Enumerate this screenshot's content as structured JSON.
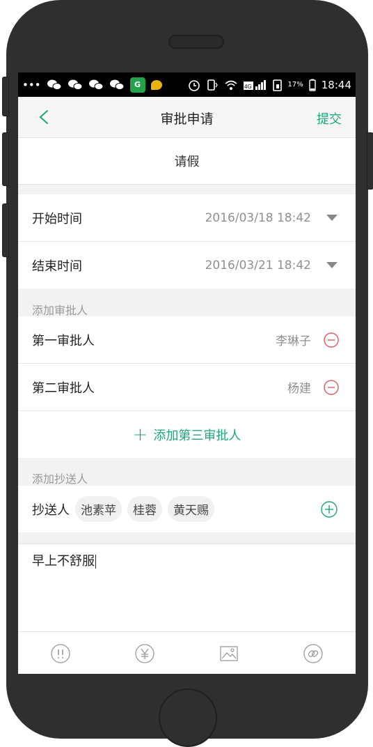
{
  "status_bar": {
    "time": "18:44",
    "battery": "17%",
    "network": "4G",
    "icons": [
      "more-dots-icon",
      "wechat-icon",
      "wechat-icon",
      "wechat-icon",
      "wechat-icon",
      "app-badge-icon",
      "message-bubble-icon",
      "alarm-icon",
      "vibrate-icon",
      "wifi-icon",
      "signal-icon",
      "sim-icon",
      "battery-icon"
    ]
  },
  "nav": {
    "title": "审批申请",
    "submit_label": "提交"
  },
  "leave_type": "请假",
  "time_fields": [
    {
      "label": "开始时间",
      "value": "2016/03/18 18:42"
    },
    {
      "label": "结束时间",
      "value": "2016/03/21 18:42"
    }
  ],
  "approvers_section_label": "添加审批人",
  "approvers": [
    {
      "label": "第一审批人",
      "name": "李琳子"
    },
    {
      "label": "第二审批人",
      "name": "杨建"
    }
  ],
  "add_approver_label": "添加第三审批人",
  "cc_section_label": "添加抄送人",
  "cc": {
    "label": "抄送人",
    "people": [
      "池素苹",
      "桂蓉",
      "黄天赐"
    ]
  },
  "note_text": "早上不舒服",
  "toolbar": {
    "icons": [
      "urgent-icon",
      "money-icon",
      "image-icon",
      "link-icon"
    ]
  },
  "colors": {
    "accent": "#1ca67a",
    "remove": "#e45a5a",
    "phone_body": "#2f2f2f"
  }
}
